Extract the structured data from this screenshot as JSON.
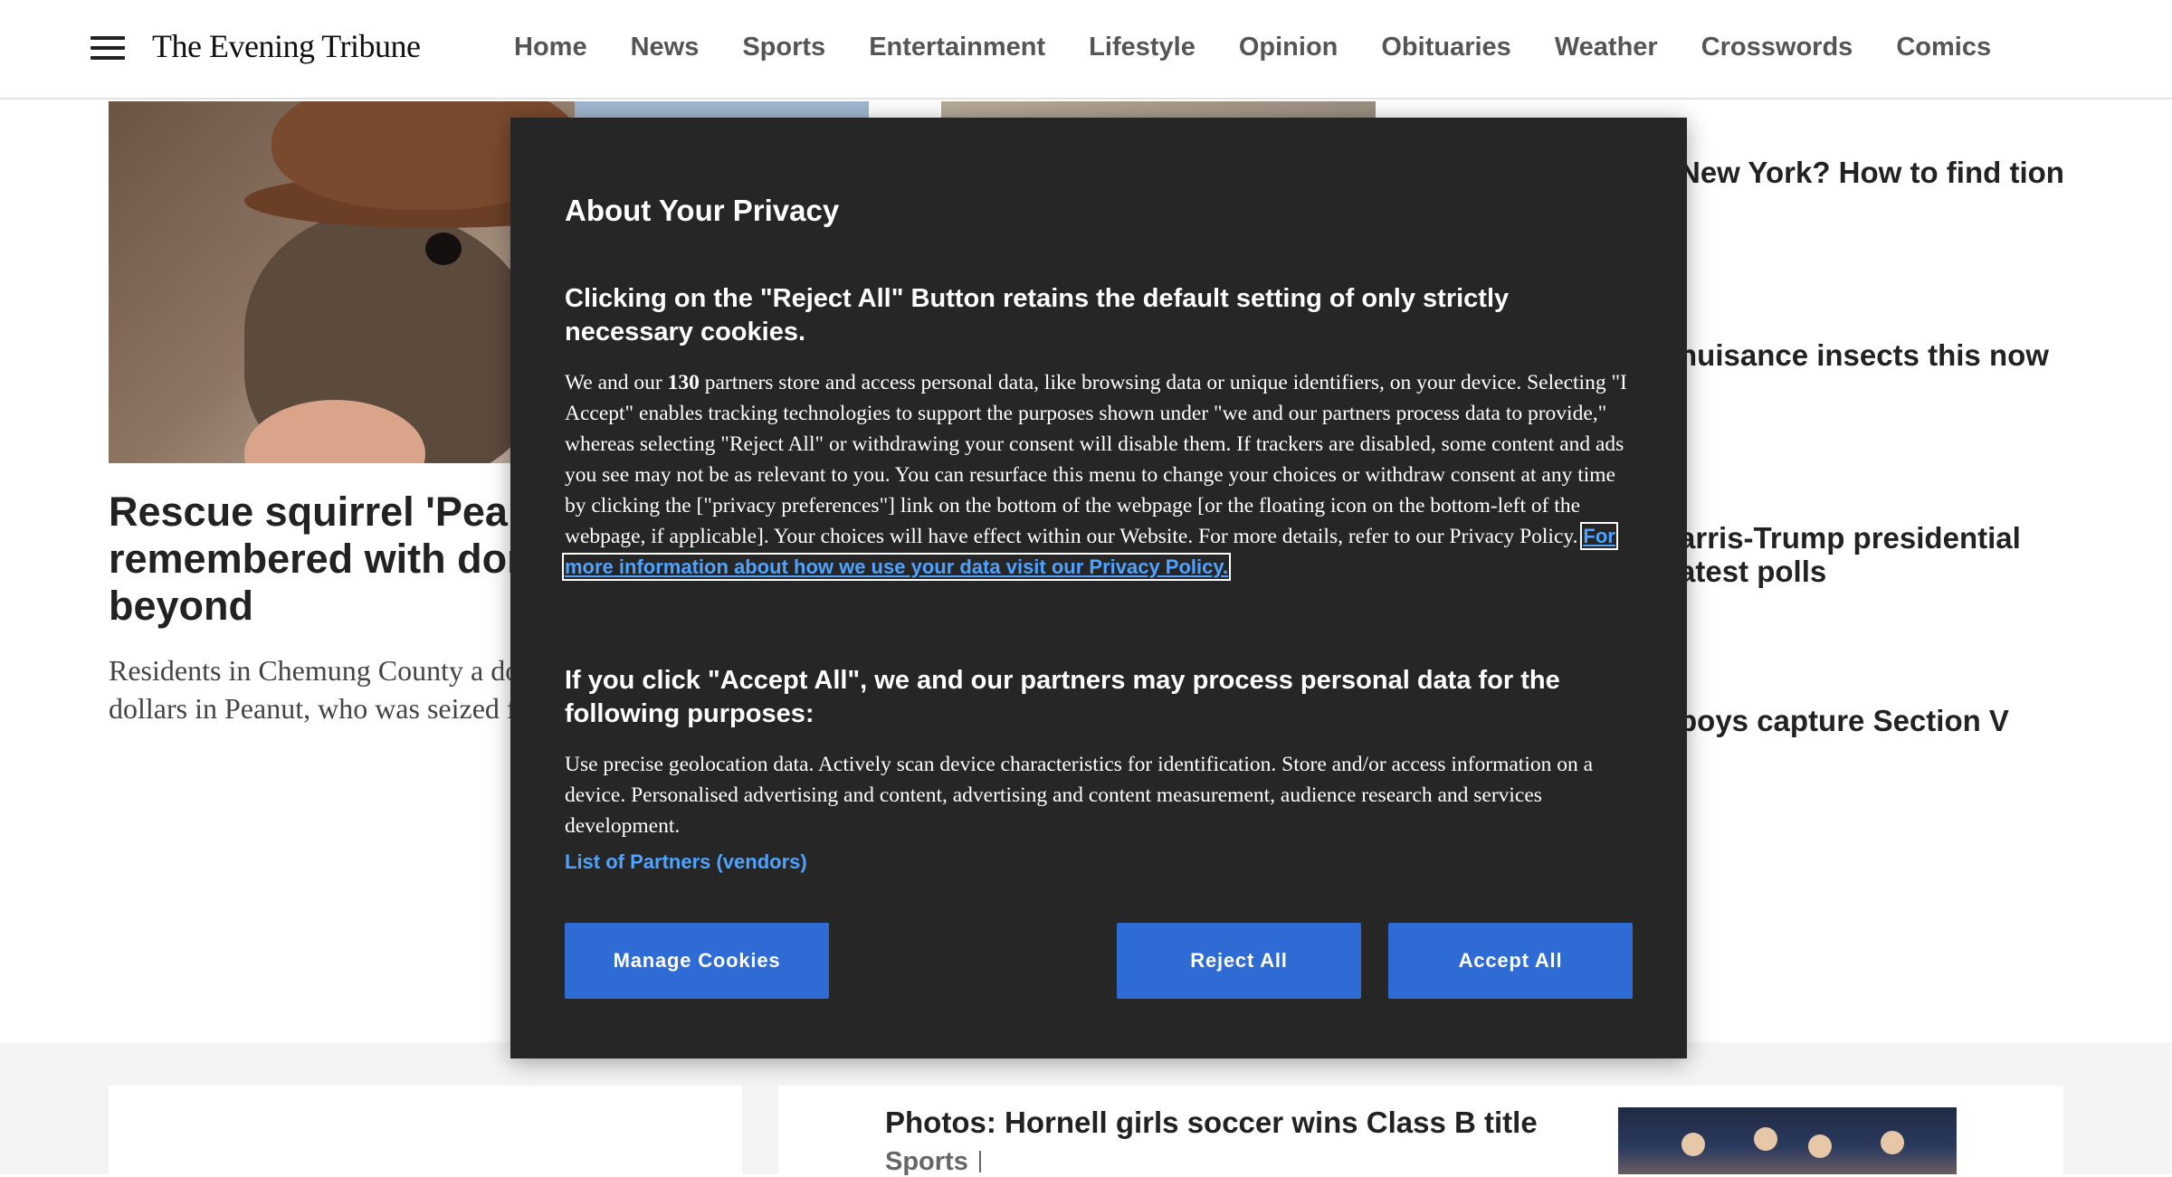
{
  "header": {
    "logo": "The Evening Tribune",
    "nav": [
      "Home",
      "News",
      "Sports",
      "Entertainment",
      "Lifestyle",
      "Opinion",
      "Obituaries",
      "Weather",
      "Crosswords",
      "Comics"
    ]
  },
  "main_story": {
    "headline": "Rescue squirrel 'Pean remembered with dor Chemung, beyond",
    "dek": "Residents in Chemung County a donated thousands of dollars in Peanut, who was seized from a I"
  },
  "side_stories": [
    "New York? How to find tion",
    "nuisance insects this now",
    "arris-Trump presidential atest polls",
    "boys capture Section V"
  ],
  "lower": {
    "headline": "Photos: Hornell girls soccer wins Class B title",
    "section": "Sports"
  },
  "privacy": {
    "title": "About Your Privacy",
    "subhead": "Clicking on the \"Reject All\" Button retains the default setting of only strictly necessary cookies.",
    "body_pre": "We and our ",
    "partners_count": "130",
    "body_post": " partners store and access personal data, like browsing data or unique identifiers, on your device. Selecting \"I Accept\" enables tracking technologies to support the purposes shown under \"we and our partners process data to provide,\" whereas selecting \"Reject All\" or withdrawing your consent will disable them. If trackers are disabled, some content and ads you see may not be as relevant to you. You can resurface this menu to change your choices or withdraw consent at any time by clicking the [\"privacy preferences\"] link on the bottom of the webpage [or the floating icon on the bottom-left of the webpage, if applicable]. Your choices will have effect within our Website. For more details, refer to our Privacy Policy. ",
    "policy_link": "For more information about how we use your data visit our Privacy Policy.",
    "subhead2": "If you click \"Accept All\", we and our partners may process personal data for the following purposes:",
    "purposes": "Use precise geolocation data. Actively scan device characteristics for identification. Store and/or access information on a device. Personalised advertising and content, advertising and content measurement, audience research and services development.",
    "partners_link": "List of Partners (vendors)",
    "manage_label": "Manage Cookies",
    "reject_label": "Reject All",
    "accept_label": "Accept All"
  },
  "colors": {
    "modal_bg": "#262626",
    "button_blue": "#2f6bd4",
    "link_blue": "#4fa3ff"
  }
}
